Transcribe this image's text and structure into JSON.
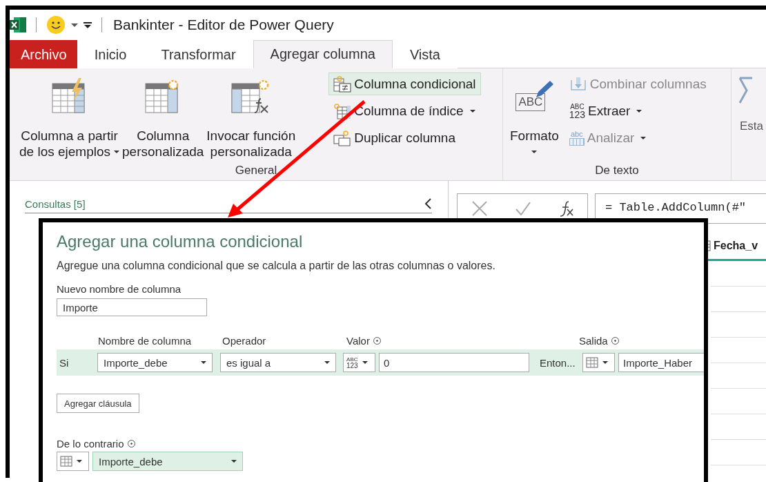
{
  "window": {
    "title": "Bankinter - Editor de Power Query"
  },
  "ribbon_tabs": [
    {
      "label": "Archivo",
      "kind": "file",
      "selected": false
    },
    {
      "label": "Inicio",
      "kind": "tab",
      "selected": false
    },
    {
      "label": "Transformar",
      "kind": "tab",
      "selected": false
    },
    {
      "label": "Agregar columna",
      "kind": "tab",
      "selected": true
    },
    {
      "label": "Vista",
      "kind": "tab",
      "selected": false
    }
  ],
  "ribbon_groups": [
    {
      "label": "General",
      "large_buttons": [
        {
          "lines": [
            "Columna a partir",
            "de los ejemplos"
          ],
          "dropdown": true
        },
        {
          "lines": [
            "Columna",
            "personalizada"
          ],
          "dropdown": false
        },
        {
          "lines": [
            "Invocar función",
            "personalizada"
          ],
          "dropdown": false
        }
      ],
      "small_buttons": [
        {
          "label": "Columna condicional",
          "dropdown": false,
          "highlighted": true,
          "disabled": false
        },
        {
          "label": "Columna de índice",
          "dropdown": true,
          "highlighted": false,
          "disabled": false
        },
        {
          "label": "Duplicar columna",
          "dropdown": false,
          "highlighted": false,
          "disabled": false
        }
      ]
    },
    {
      "label": "De texto",
      "large_buttons": [
        {
          "lines": [
            "Formato"
          ],
          "dropdown": true,
          "icon_text": [
            "ABC"
          ]
        }
      ],
      "small_buttons": [
        {
          "label": "Combinar columnas",
          "dropdown": false,
          "highlighted": false,
          "disabled": true
        },
        {
          "label": "Extraer",
          "dropdown": true,
          "highlighted": false,
          "disabled": false,
          "icon_text": [
            "ABC",
            "123"
          ]
        },
        {
          "label": "Analizar",
          "dropdown": true,
          "highlighted": false,
          "disabled": true,
          "icon_text": [
            "abc"
          ]
        }
      ]
    }
  ],
  "ribbon_partial_group": {
    "label": "Esta"
  },
  "queries_pane": {
    "title": "Consultas [5]"
  },
  "formula_bar": {
    "formula": "= Table.AddColumn(#\""
  },
  "grid": {
    "column_header": "Fecha_v"
  },
  "dialog": {
    "title": "Agregar una columna condicional",
    "description": "Agregue una columna condicional que se calcula a partir de las otras columnas o valores.",
    "new_column_label": "Nuevo nombre de columna",
    "new_column_value": "Importe",
    "headers": [
      {
        "label": "Nombre de columna",
        "info": false
      },
      {
        "label": "Operador",
        "info": false
      },
      {
        "label": "Valor",
        "info": true
      },
      {
        "label": "Salida",
        "info": true
      }
    ],
    "clause": {
      "prefix": "Si",
      "column": "Importe_debe",
      "operator": "es igual a",
      "value_type": [
        "ABC",
        "123"
      ],
      "value": "0",
      "then": "Enton...",
      "output": "Importe_Haber"
    },
    "add_clause_button": "Agregar cláusula",
    "else": {
      "label": "De lo contrario",
      "info": true,
      "value": "Importe_debe"
    }
  }
}
